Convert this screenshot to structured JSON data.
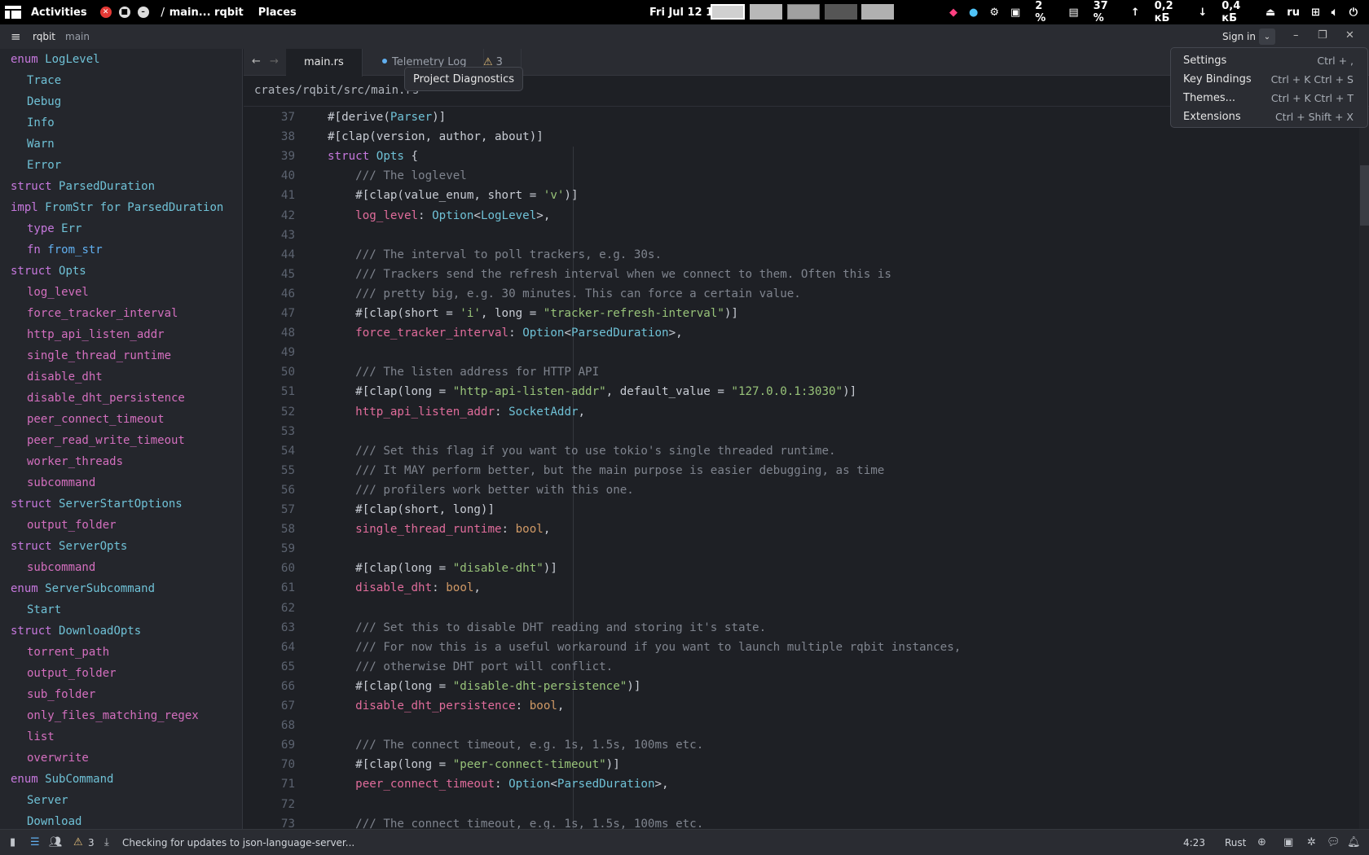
{
  "system_bar": {
    "activities": "Activities",
    "app_indicator": "main... rqbit",
    "places": "Places",
    "datetime": "Fri Jul 12  16:23",
    "cpu": "2 %",
    "memory": "37 %",
    "upload": "0,2 кБ",
    "download": "0,4 кБ",
    "keyboard_layout": "ru"
  },
  "titlebar": {
    "project": "rqbit",
    "branch": "main",
    "sign_in": "Sign in"
  },
  "tabs": [
    {
      "label": "main.rs",
      "active": true
    },
    {
      "label": "Telemetry Log",
      "active": false
    },
    {
      "label": "3",
      "active": false
    }
  ],
  "tooltip": "Project Diagnostics",
  "breadcrumb": "crates/rqbit/src/main.rs",
  "menu": [
    {
      "label": "Settings",
      "shortcut": "Ctrl + ,"
    },
    {
      "label": "Key Bindings",
      "shortcut": "Ctrl + K  Ctrl + S"
    },
    {
      "label": "Themes...",
      "shortcut": "Ctrl + K  Ctrl + T"
    },
    {
      "label": "Extensions",
      "shortcut": "Ctrl + Shift + X"
    }
  ],
  "outline": [
    {
      "kw": "enum",
      "name": "LogLevel",
      "indent": 0,
      "kind": "type"
    },
    {
      "kw": "",
      "name": "Trace",
      "indent": 1,
      "kind": "type"
    },
    {
      "kw": "",
      "name": "Debug",
      "indent": 1,
      "kind": "type"
    },
    {
      "kw": "",
      "name": "Info",
      "indent": 1,
      "kind": "type"
    },
    {
      "kw": "",
      "name": "Warn",
      "indent": 1,
      "kind": "type"
    },
    {
      "kw": "",
      "name": "Error",
      "indent": 1,
      "kind": "type"
    },
    {
      "kw": "struct",
      "name": "ParsedDuration",
      "indent": 0,
      "kind": "type"
    },
    {
      "kw": "impl",
      "name": "FromStr for ParsedDuration",
      "indent": 0,
      "kind": "impl"
    },
    {
      "kw": "type",
      "name": "Err",
      "indent": 1,
      "kind": "type"
    },
    {
      "kw": "fn",
      "name": "from_str",
      "indent": 1,
      "kind": "fn"
    },
    {
      "kw": "struct",
      "name": "Opts",
      "indent": 0,
      "kind": "type"
    },
    {
      "kw": "",
      "name": "log_level",
      "indent": 1,
      "kind": "field"
    },
    {
      "kw": "",
      "name": "force_tracker_interval",
      "indent": 1,
      "kind": "field"
    },
    {
      "kw": "",
      "name": "http_api_listen_addr",
      "indent": 1,
      "kind": "field"
    },
    {
      "kw": "",
      "name": "single_thread_runtime",
      "indent": 1,
      "kind": "field"
    },
    {
      "kw": "",
      "name": "disable_dht",
      "indent": 1,
      "kind": "field"
    },
    {
      "kw": "",
      "name": "disable_dht_persistence",
      "indent": 1,
      "kind": "field"
    },
    {
      "kw": "",
      "name": "peer_connect_timeout",
      "indent": 1,
      "kind": "field"
    },
    {
      "kw": "",
      "name": "peer_read_write_timeout",
      "indent": 1,
      "kind": "field"
    },
    {
      "kw": "",
      "name": "worker_threads",
      "indent": 1,
      "kind": "field"
    },
    {
      "kw": "",
      "name": "subcommand",
      "indent": 1,
      "kind": "field"
    },
    {
      "kw": "struct",
      "name": "ServerStartOptions",
      "indent": 0,
      "kind": "type"
    },
    {
      "kw": "",
      "name": "output_folder",
      "indent": 1,
      "kind": "field"
    },
    {
      "kw": "struct",
      "name": "ServerOpts",
      "indent": 0,
      "kind": "type"
    },
    {
      "kw": "",
      "name": "subcommand",
      "indent": 1,
      "kind": "field"
    },
    {
      "kw": "enum",
      "name": "ServerSubcommand",
      "indent": 0,
      "kind": "type"
    },
    {
      "kw": "",
      "name": "Start",
      "indent": 1,
      "kind": "type"
    },
    {
      "kw": "struct",
      "name": "DownloadOpts",
      "indent": 0,
      "kind": "type"
    },
    {
      "kw": "",
      "name": "torrent_path",
      "indent": 1,
      "kind": "field"
    },
    {
      "kw": "",
      "name": "output_folder",
      "indent": 1,
      "kind": "field"
    },
    {
      "kw": "",
      "name": "sub_folder",
      "indent": 1,
      "kind": "field"
    },
    {
      "kw": "",
      "name": "only_files_matching_regex",
      "indent": 1,
      "kind": "field"
    },
    {
      "kw": "",
      "name": "list",
      "indent": 1,
      "kind": "field"
    },
    {
      "kw": "",
      "name": "overwrite",
      "indent": 1,
      "kind": "field"
    },
    {
      "kw": "enum",
      "name": "SubCommand",
      "indent": 0,
      "kind": "type"
    },
    {
      "kw": "",
      "name": "Server",
      "indent": 1,
      "kind": "type"
    },
    {
      "kw": "",
      "name": "Download",
      "indent": 1,
      "kind": "type"
    }
  ],
  "code_lines": [
    {
      "n": "37",
      "t": "#[derive(Parser)]"
    },
    {
      "n": "38",
      "t": "#[clap(version, author, about)]"
    },
    {
      "n": "39",
      "t": "struct Opts {"
    },
    {
      "n": "40",
      "t": "    /// The loglevel"
    },
    {
      "n": "41",
      "t": "    #[clap(value_enum, short = 'v')]"
    },
    {
      "n": "42",
      "t": "    log_level: Option<LogLevel>,"
    },
    {
      "n": "43",
      "t": ""
    },
    {
      "n": "44",
      "t": "    /// The interval to poll trackers, e.g. 30s."
    },
    {
      "n": "45",
      "t": "    /// Trackers send the refresh interval when we connect to them. Often this is"
    },
    {
      "n": "46",
      "t": "    /// pretty big, e.g. 30 minutes. This can force a certain value."
    },
    {
      "n": "47",
      "t": "    #[clap(short = 'i', long = \"tracker-refresh-interval\")]"
    },
    {
      "n": "48",
      "t": "    force_tracker_interval: Option<ParsedDuration>,"
    },
    {
      "n": "49",
      "t": ""
    },
    {
      "n": "50",
      "t": "    /// The listen address for HTTP API"
    },
    {
      "n": "51",
      "t": "    #[clap(long = \"http-api-listen-addr\", default_value = \"127.0.0.1:3030\")]"
    },
    {
      "n": "52",
      "t": "    http_api_listen_addr: SocketAddr,"
    },
    {
      "n": "53",
      "t": ""
    },
    {
      "n": "54",
      "t": "    /// Set this flag if you want to use tokio's single threaded runtime."
    },
    {
      "n": "55",
      "t": "    /// It MAY perform better, but the main purpose is easier debugging, as time"
    },
    {
      "n": "56",
      "t": "    /// profilers work better with this one."
    },
    {
      "n": "57",
      "t": "    #[clap(short, long)]"
    },
    {
      "n": "58",
      "t": "    single_thread_runtime: bool,"
    },
    {
      "n": "59",
      "t": ""
    },
    {
      "n": "60",
      "t": "    #[clap(long = \"disable-dht\")]"
    },
    {
      "n": "61",
      "t": "    disable_dht: bool,"
    },
    {
      "n": "62",
      "t": ""
    },
    {
      "n": "63",
      "t": "    /// Set this to disable DHT reading and storing it's state."
    },
    {
      "n": "64",
      "t": "    /// For now this is a useful workaround if you want to launch multiple rqbit instances,"
    },
    {
      "n": "65",
      "t": "    /// otherwise DHT port will conflict."
    },
    {
      "n": "66",
      "t": "    #[clap(long = \"disable-dht-persistence\")]"
    },
    {
      "n": "67",
      "t": "    disable_dht_persistence: bool,"
    },
    {
      "n": "68",
      "t": ""
    },
    {
      "n": "69",
      "t": "    /// The connect timeout, e.g. 1s, 1.5s, 100ms etc."
    },
    {
      "n": "70",
      "t": "    #[clap(long = \"peer-connect-timeout\")]"
    },
    {
      "n": "71",
      "t": "    peer_connect_timeout: Option<ParsedDuration>,"
    },
    {
      "n": "72",
      "t": ""
    },
    {
      "n": "73",
      "t": "    /// The connect timeout, e.g. 1s, 1.5s, 100ms etc."
    }
  ],
  "statusbar": {
    "diagnostics_count": "3",
    "message": "Checking for updates to json-language-server...",
    "cursor": "4:23",
    "language": "Rust"
  }
}
